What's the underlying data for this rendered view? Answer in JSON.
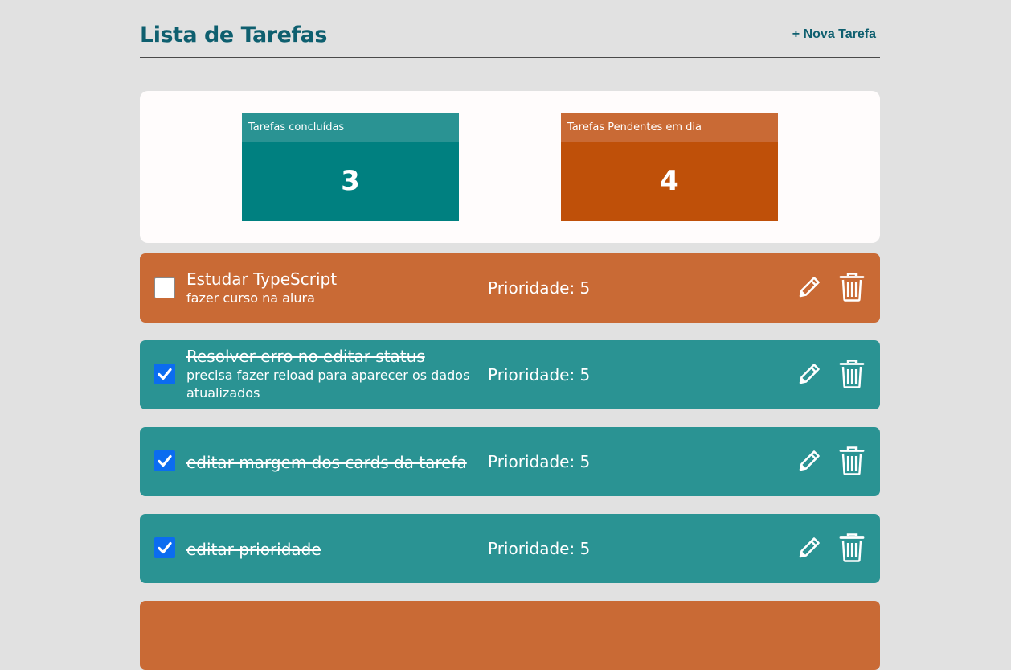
{
  "header": {
    "title": "Lista de Tarefas",
    "new_task_label": "+ Nova Tarefa"
  },
  "summary": {
    "done": {
      "label": "Tarefas concluídas",
      "value": "3"
    },
    "pending": {
      "label": "Tarefas Pendentes em dia",
      "value": "4"
    }
  },
  "colors": {
    "pending_card": "#c96a35",
    "done_card": "#2a9393",
    "title": "#0e5f6f"
  },
  "tasks": [
    {
      "title": "Estudar TypeScript",
      "description": "fazer curso na alura",
      "priority": "Prioridade: 5",
      "done": false
    },
    {
      "title": "Resolver erro no editar status",
      "description": "precisa fazer reload para aparecer os dados atualizados",
      "priority": "Prioridade: 5",
      "done": true
    },
    {
      "title": "editar margem dos cards da tarefa",
      "description": "",
      "priority": "Prioridade: 5",
      "done": true
    },
    {
      "title": "editar prioridade",
      "description": "",
      "priority": "Prioridade: 5",
      "done": true
    }
  ],
  "icons": {
    "edit": "pencil-icon",
    "delete": "trash-icon",
    "check": "checkmark-icon"
  }
}
